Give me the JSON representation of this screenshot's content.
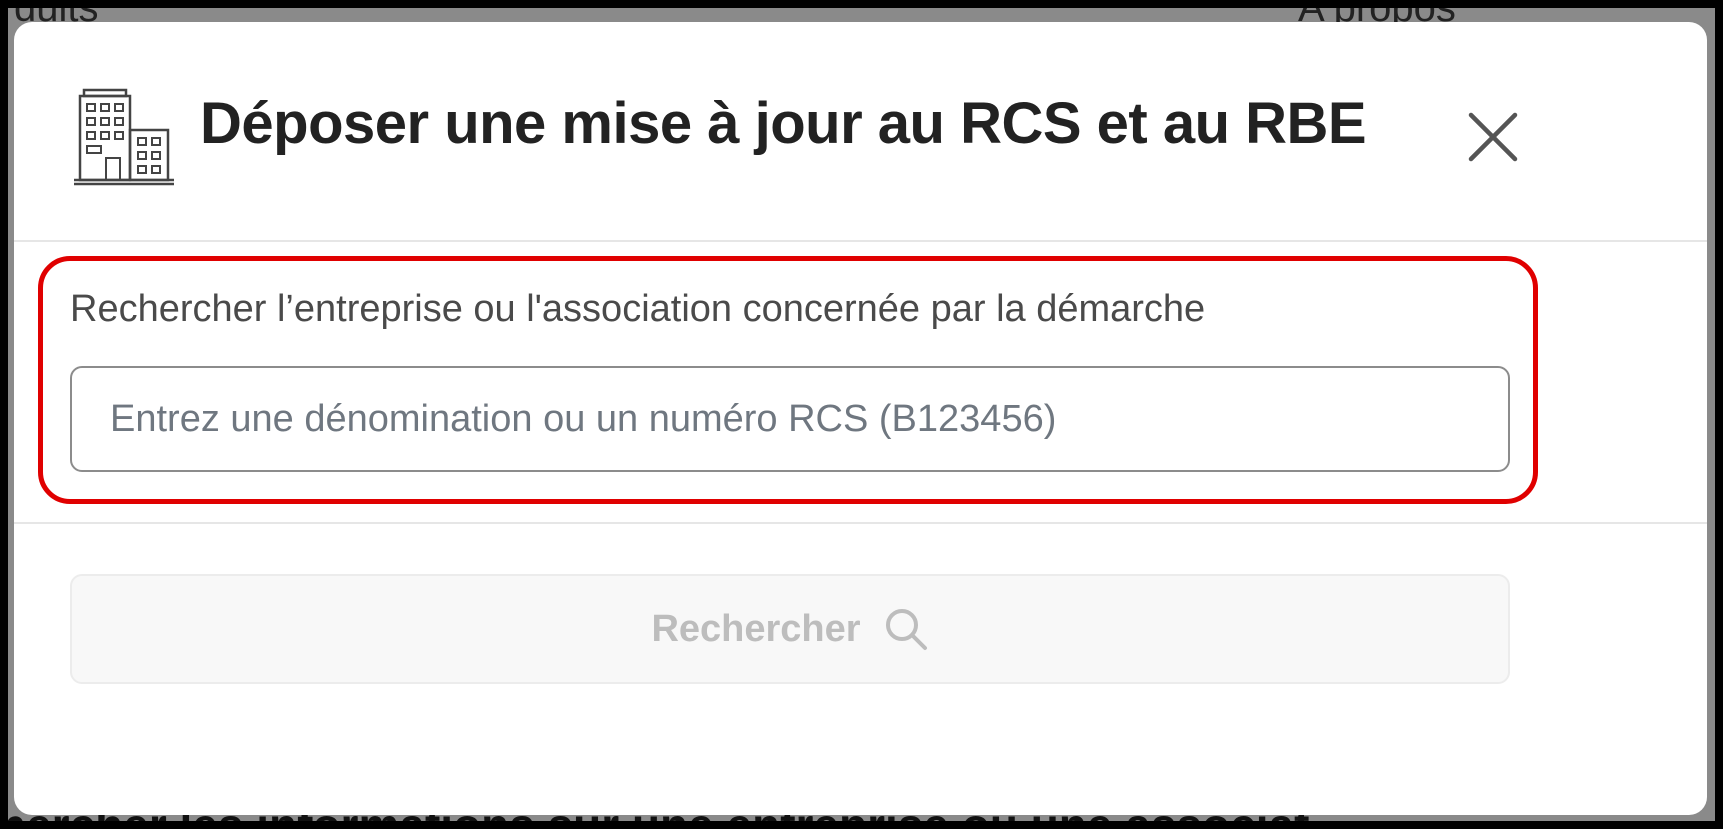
{
  "background": {
    "top_left_text": "duits",
    "top_right_text": "A propos",
    "bottom_text": "hercher les informations sur une entreprise ou une associat"
  },
  "modal": {
    "title": "Déposer une mise à jour au RCS et au RBE",
    "header_icon": "building-icon",
    "close_icon": "close-icon",
    "search": {
      "label": "Rechercher l’entreprise ou l'association concernée par la démarche",
      "placeholder": "Entrez une dénomination ou un numéro RCS (B123456)",
      "value": ""
    },
    "search_button": {
      "label": "Rechercher",
      "icon": "search-icon",
      "disabled": true
    }
  },
  "colors": {
    "highlight": "#e00000",
    "title": "#222222",
    "disabled_button_text": "#bdbdbd"
  }
}
